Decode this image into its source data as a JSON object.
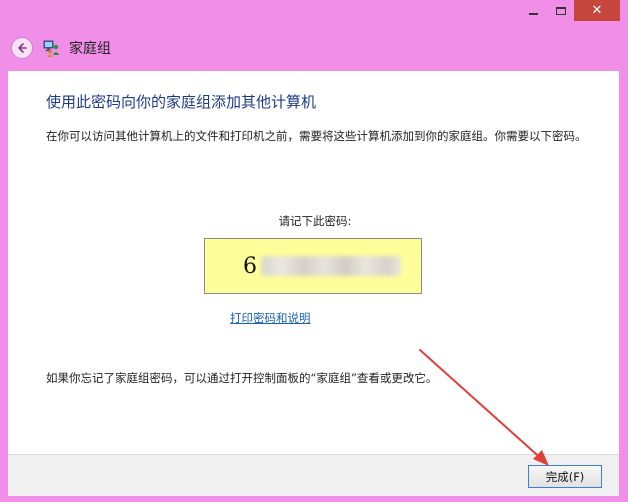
{
  "window": {
    "caption": {
      "minimize_icon": "minimize-icon",
      "maximize_icon": "maximize-icon",
      "close_glyph": "✕"
    }
  },
  "nav": {
    "back_glyph": "←",
    "title": "家庭组"
  },
  "main": {
    "heading": "使用此密码向你的家庭组添加其他计算机",
    "description": "在你可以访问其他计算机上的文件和打印机之前，需要将这些计算机添加到你的家庭组。你需要以下密码。",
    "password_label": "请记下此密码:",
    "password_visible_prefix": "6",
    "print_link": "打印密码和说明",
    "footer_note": "如果你忘记了家庭组密码，可以通过打开控制面板的“家庭组”查看或更改它。"
  },
  "command_bar": {
    "finish_label": "完成(F)"
  },
  "colors": {
    "window_frame": "#f08ee8",
    "heading_blue": "#1e3b8a",
    "link_blue": "#1a5fb4",
    "password_bg": "#fefe9a",
    "close_red": "#c7463c",
    "annotation_arrow": "#e0403a"
  }
}
